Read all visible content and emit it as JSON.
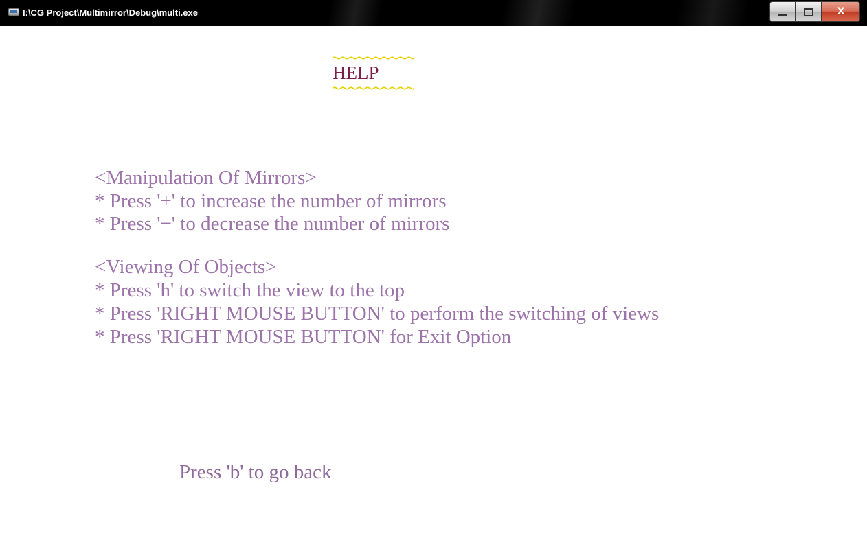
{
  "window": {
    "title": "I:\\CG Project\\Multimirror\\Debug\\multi.exe",
    "icon": "application-icon",
    "controls": {
      "minimize_icon": "minimize-icon",
      "maximize_icon": "restore-icon",
      "close_glyph": "X"
    }
  },
  "help": {
    "title": "HELP",
    "accent_color": "#e6d200",
    "title_color": "#7a1f4a",
    "text_color": "#9c74a9"
  },
  "sections": [
    {
      "heading": "<Manipulation Of Mirrors>",
      "lines": [
        "* Press '+' to increase the number of mirrors",
        "* Press '−' to decrease the number of mirrors"
      ]
    },
    {
      "heading": "<Viewing Of Objects>",
      "lines": [
        "* Press 'h' to switch the view to the top",
        "* Press 'RIGHT MOUSE BUTTON' to perform the switching of views",
        "* Press 'RIGHT MOUSE BUTTON' for Exit Option"
      ]
    }
  ],
  "footer": {
    "back_hint": "Press 'b' to go back"
  }
}
